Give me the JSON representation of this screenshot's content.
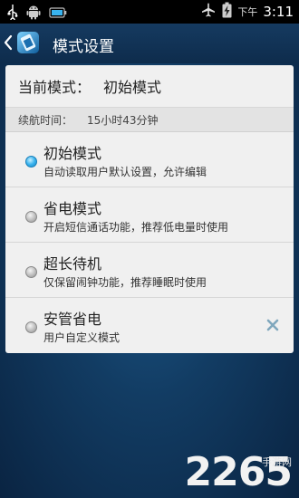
{
  "status_bar": {
    "ampm": "下午",
    "time": "3:11",
    "icons": [
      "usb-icon",
      "android-icon",
      "battery-saver-icon",
      "airplane-mode-icon",
      "battery-charging-icon"
    ]
  },
  "action_bar": {
    "title": "模式设置",
    "icons": [
      "back-chevron-icon",
      "app-icon"
    ]
  },
  "current_mode": {
    "label": "当前模式：",
    "value": "初始模式"
  },
  "battery_life": {
    "label": "续航时间：",
    "value": "15小时43分钟"
  },
  "modes": [
    {
      "name": "初始模式",
      "description": "自动读取用户默认设置，允许编辑",
      "selected": true
    },
    {
      "name": "省电模式",
      "description": "开启短信通话功能，推荐低电量时使用",
      "selected": false
    },
    {
      "name": "超长待机",
      "description": "仅保留闹钟功能，推荐睡眠时使用",
      "selected": false
    },
    {
      "name": "安管省电",
      "description": "用户自定义模式",
      "selected": false,
      "deletable": true
    }
  ],
  "watermark": {
    "digits": "2265",
    "sub": "手游网"
  },
  "colors": {
    "radio_selected": "#39b3ee",
    "delete_x": "#7fa7bd"
  }
}
